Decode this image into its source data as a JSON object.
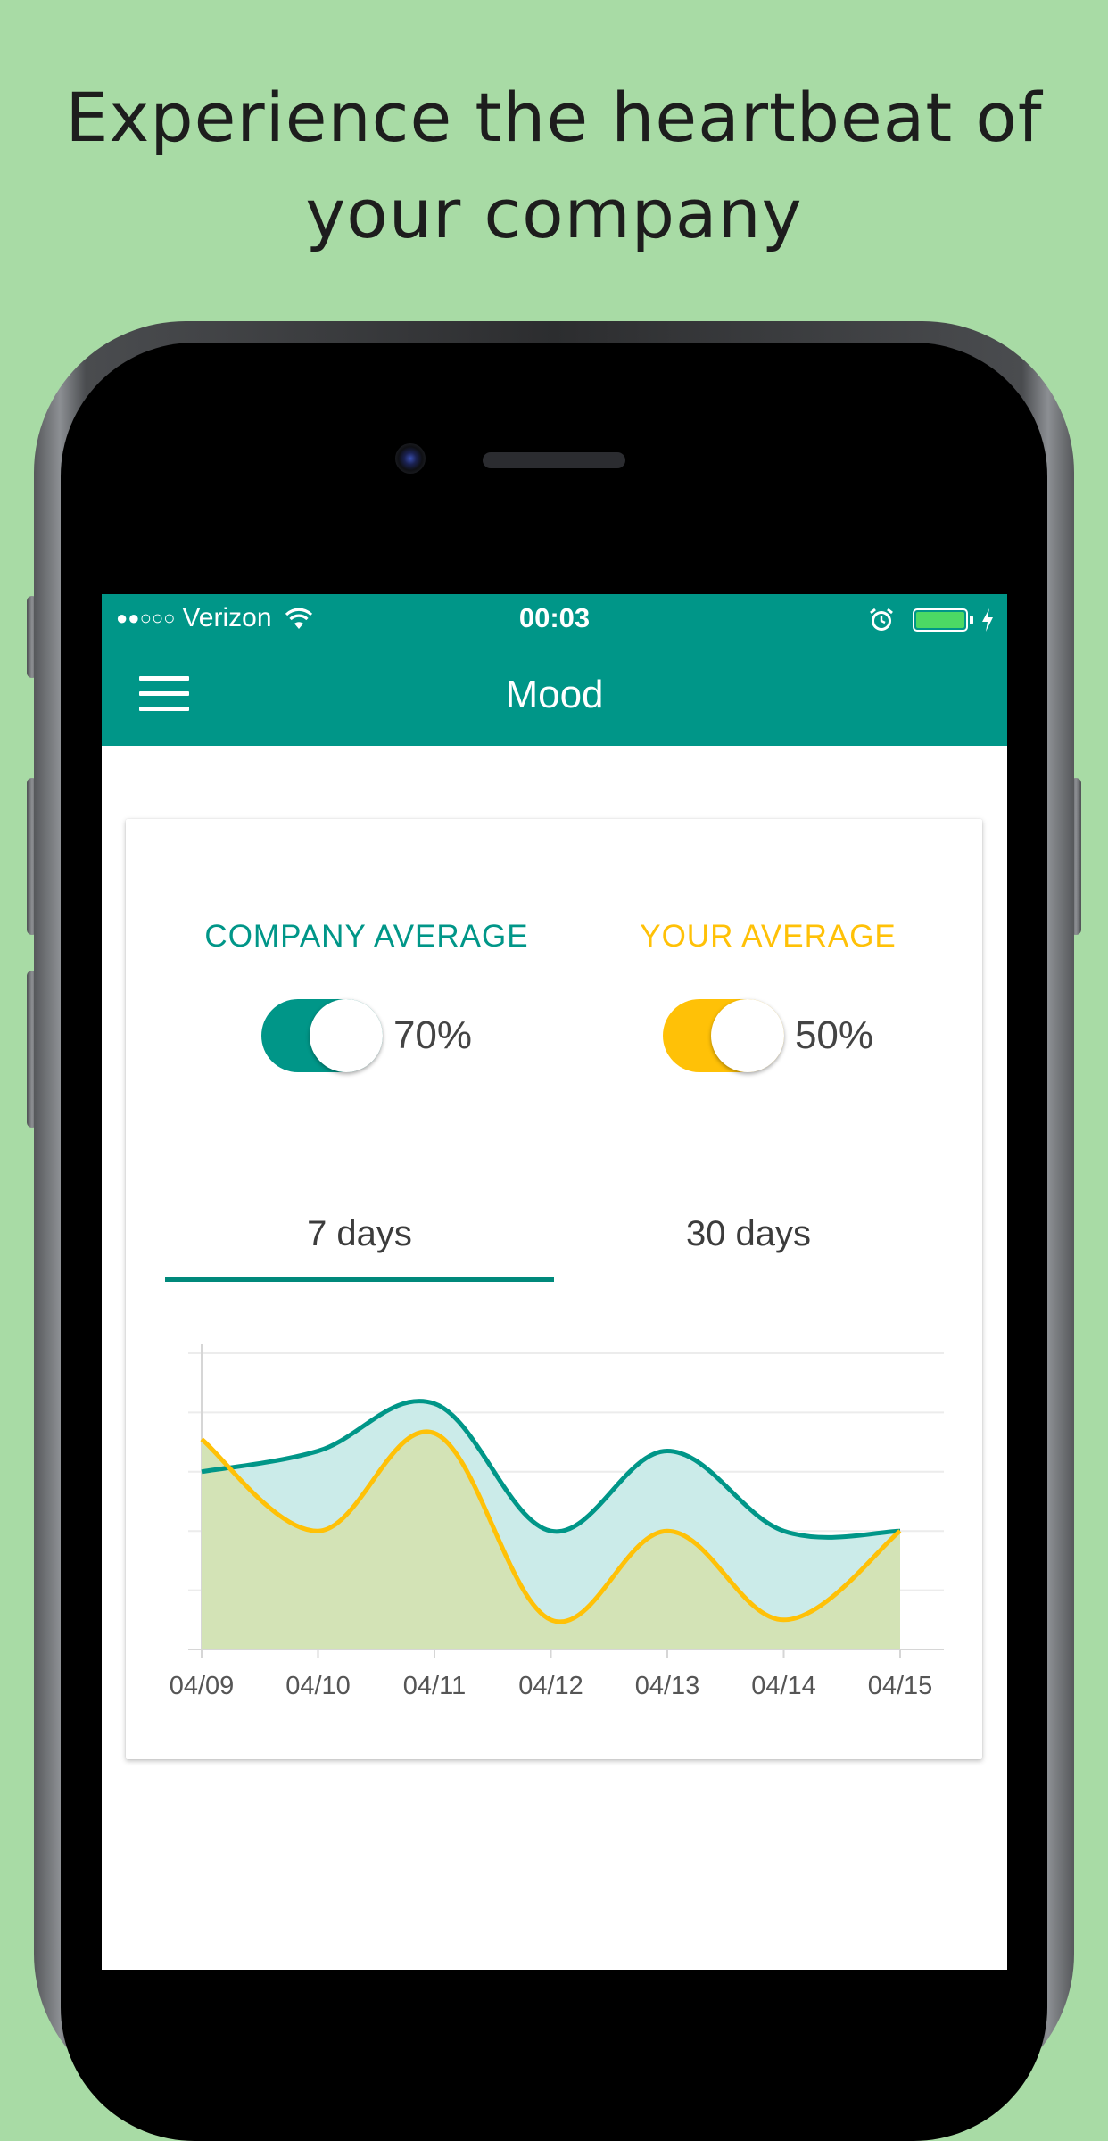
{
  "headline": {
    "line1": "Experience the heartbeat of",
    "line2": "your company"
  },
  "status_bar": {
    "signal": "●●○○○",
    "carrier": "Verizon",
    "time": "00:03",
    "icons": [
      "wifi-icon",
      "alarm-icon",
      "battery-icon",
      "charging-icon"
    ]
  },
  "app_bar": {
    "menu_icon": "hamburger-menu-icon",
    "title": "Mood"
  },
  "averages": {
    "company": {
      "label": "COMPANY AVERAGE",
      "value": "70%",
      "enabled": true,
      "color": "#009688"
    },
    "yours": {
      "label": "YOUR AVERAGE",
      "value": "50%",
      "enabled": true,
      "color": "#ffc107"
    }
  },
  "tabs": {
    "items": [
      "7 days",
      "30 days"
    ],
    "selected": "7 days"
  },
  "chart_data": {
    "type": "area",
    "categories": [
      "04/09",
      "04/10",
      "04/11",
      "04/12",
      "04/13",
      "04/14",
      "04/15"
    ],
    "series": [
      {
        "values": [
          60,
          67,
          83,
          40,
          67,
          40,
          40
        ],
        "color": "#009688",
        "fill": "#cbebe9"
      },
      {
        "values": [
          71,
          40,
          73,
          10,
          40,
          10,
          40
        ],
        "color": "#ffc107",
        "fill": "#d3e3b6"
      }
    ],
    "ylim": [
      0,
      100
    ],
    "grid": true,
    "title": "",
    "xlabel": "",
    "ylabel": ""
  }
}
